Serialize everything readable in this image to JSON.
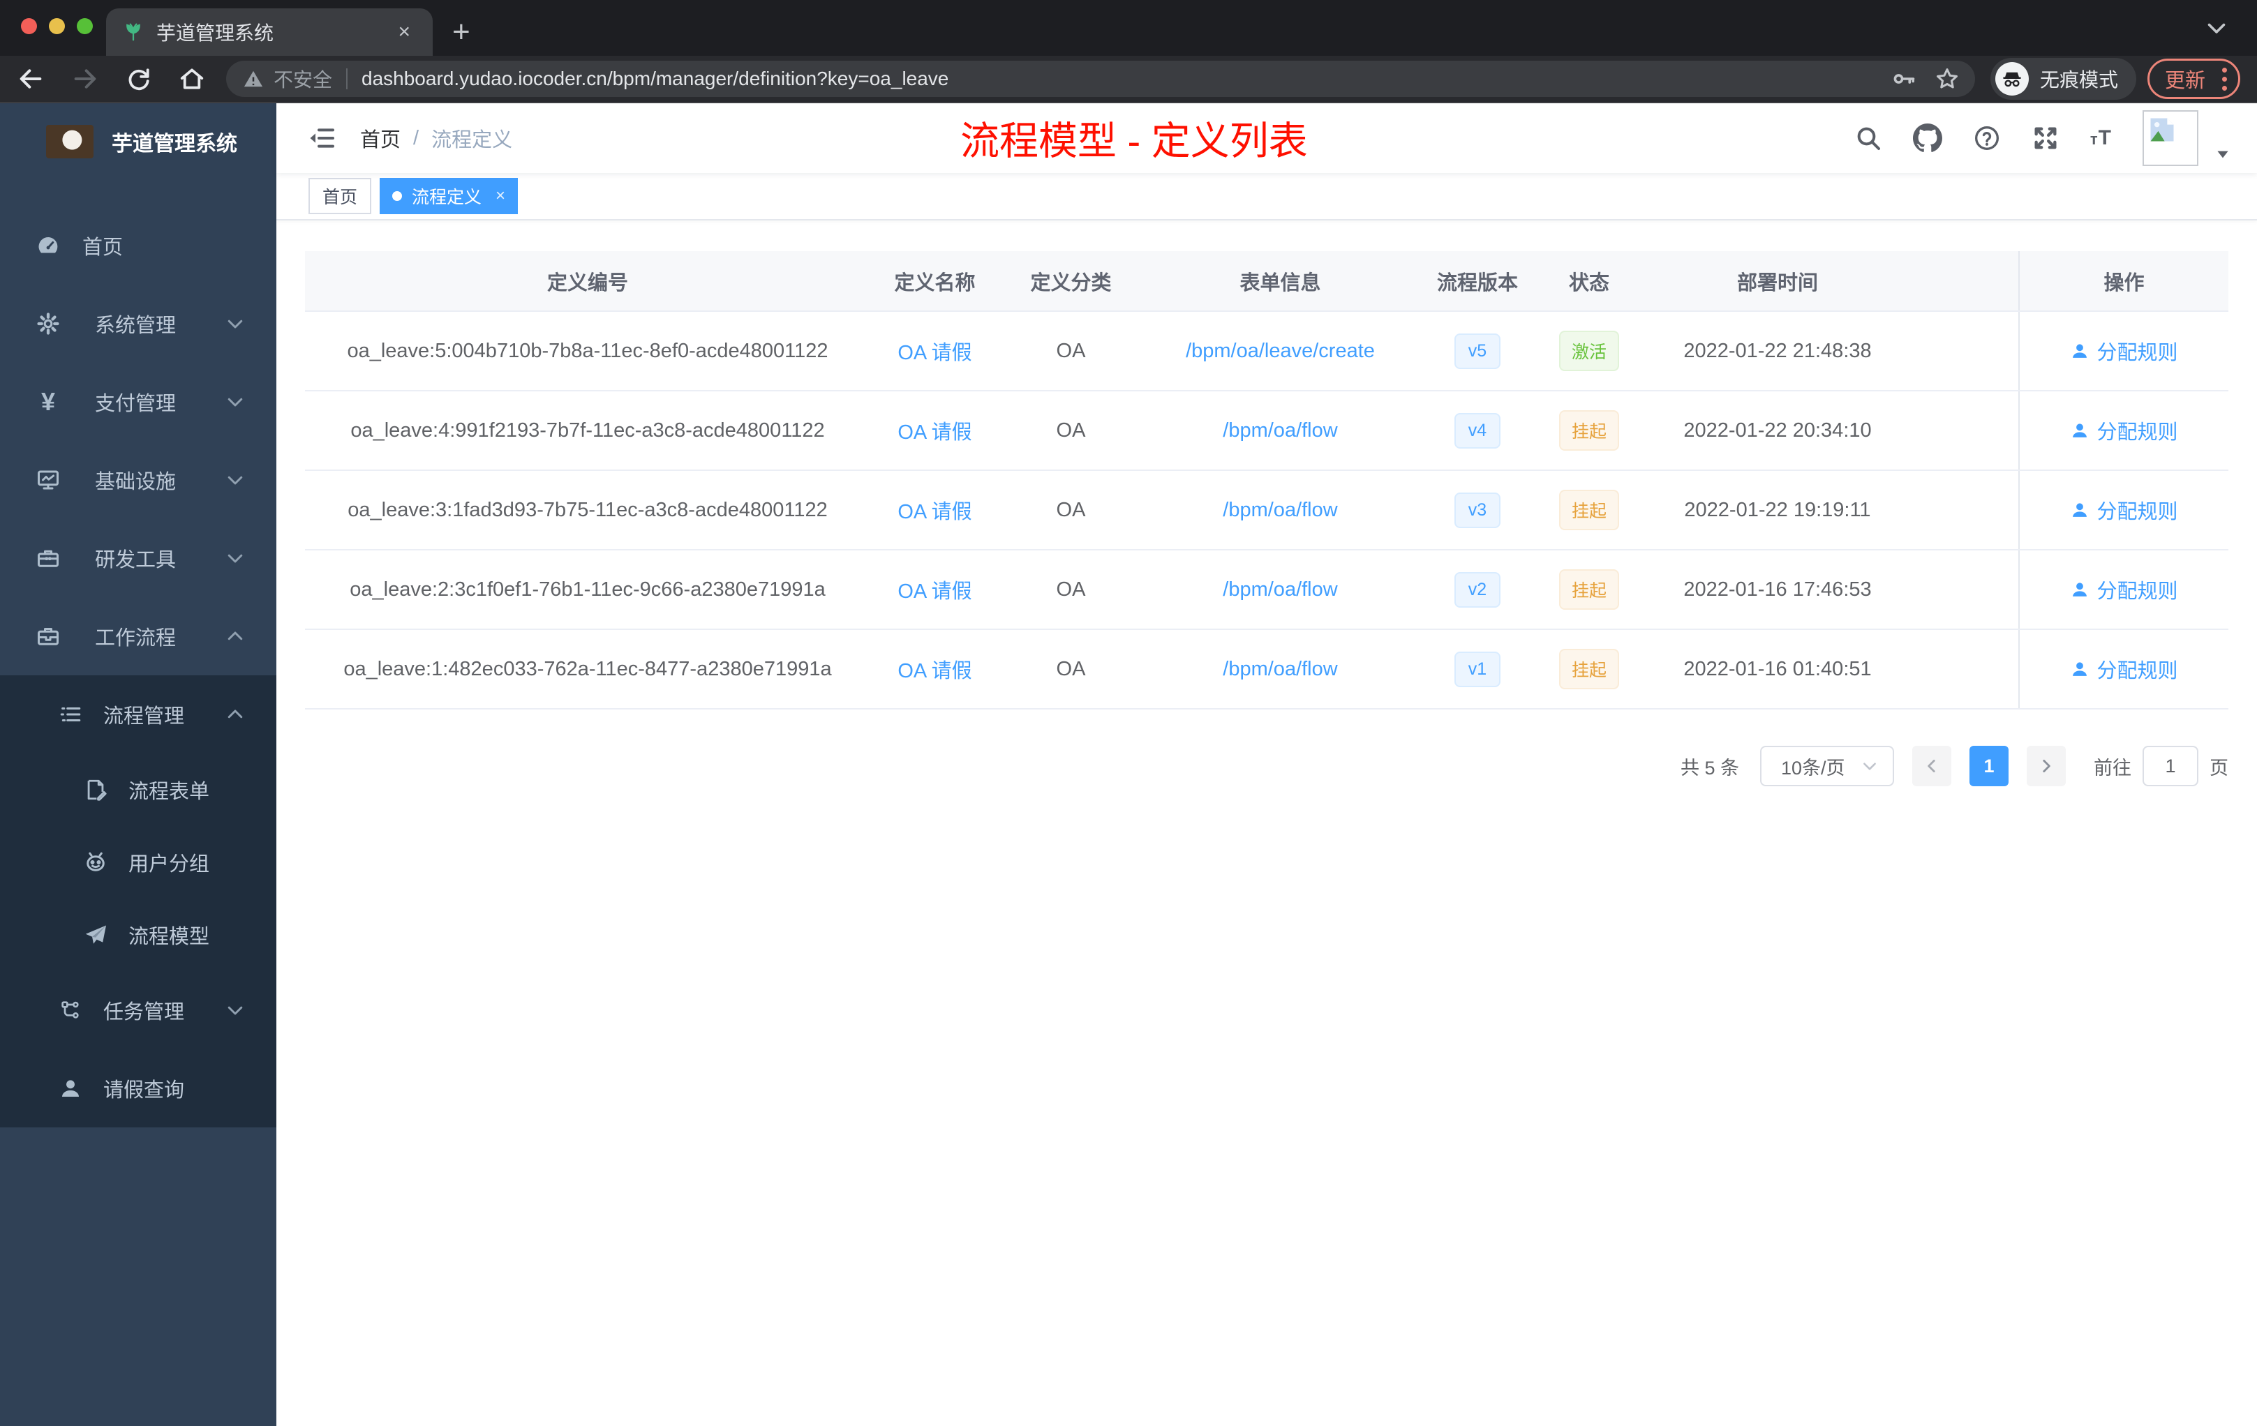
{
  "browser": {
    "tab_title": "芋道管理系统",
    "security_label": "不安全",
    "url": "dashboard.yudao.iocoder.cn/bpm/manager/definition?key=oa_leave",
    "incognito_label": "无痕模式",
    "update_label": "更新"
  },
  "sidebar": {
    "title": "芋道管理系统",
    "items": [
      {
        "label": "首页"
      },
      {
        "label": "系统管理"
      },
      {
        "label": "支付管理"
      },
      {
        "label": "基础设施"
      },
      {
        "label": "研发工具"
      },
      {
        "label": "工作流程"
      }
    ],
    "workflow_children": [
      {
        "label": "流程管理"
      },
      {
        "label": "流程表单"
      },
      {
        "label": "用户分组"
      },
      {
        "label": "流程模型"
      },
      {
        "label": "任务管理"
      },
      {
        "label": "请假查询"
      }
    ]
  },
  "navbar": {
    "breadcrumb_home": "首页",
    "breadcrumb_sep": "/",
    "breadcrumb_current": "流程定义",
    "annotation": "流程模型 - 定义列表",
    "font_icon_small": "т",
    "font_icon_big": "T"
  },
  "tags": {
    "home": "首页",
    "active": "流程定义",
    "close": "×"
  },
  "table": {
    "headers": [
      "定义编号",
      "定义名称",
      "定义分类",
      "表单信息",
      "流程版本",
      "状态",
      "部署时间",
      "操作"
    ],
    "action_label": "分配规则",
    "rows": [
      {
        "id": "oa_leave:5:004b710b-7b8a-11ec-8ef0-acde48001122",
        "name": "OA 请假",
        "category": "OA",
        "form": "/bpm/oa/leave/create",
        "version": "v5",
        "status": "激活",
        "time": "2022-01-22 21:48:38"
      },
      {
        "id": "oa_leave:4:991f2193-7b7f-11ec-a3c8-acde48001122",
        "name": "OA 请假",
        "category": "OA",
        "form": "/bpm/oa/flow",
        "version": "v4",
        "status": "挂起",
        "time": "2022-01-22 20:34:10"
      },
      {
        "id": "oa_leave:3:1fad3d93-7b75-11ec-a3c8-acde48001122",
        "name": "OA 请假",
        "category": "OA",
        "form": "/bpm/oa/flow",
        "version": "v3",
        "status": "挂起",
        "time": "2022-01-22 19:19:11"
      },
      {
        "id": "oa_leave:2:3c1f0ef1-76b1-11ec-9c66-a2380e71991a",
        "name": "OA 请假",
        "category": "OA",
        "form": "/bpm/oa/flow",
        "version": "v2",
        "status": "挂起",
        "time": "2022-01-16 17:46:53"
      },
      {
        "id": "oa_leave:1:482ec033-762a-11ec-8477-a2380e71991a",
        "name": "OA 请假",
        "category": "OA",
        "form": "/bpm/oa/flow",
        "version": "v1",
        "status": "挂起",
        "time": "2022-01-16 01:40:51"
      }
    ]
  },
  "pagination": {
    "total": "共 5 条",
    "page_size": "10条/页",
    "current_page": "1",
    "goto_label": "前往",
    "goto_value": "1",
    "page_unit": "页"
  },
  "colors": {
    "accent": "#409eff",
    "success": "#67c23a",
    "warning": "#e6a23c",
    "annotation_red": "#fe1000",
    "sidebar_bg": "#304156",
    "submenu_bg": "#1f2d3d"
  },
  "icon_names": [
    "plant-favicon",
    "close-icon",
    "new-tab-icon",
    "tab-search-icon",
    "back-icon",
    "forward-icon",
    "reload-icon",
    "home-icon",
    "warning-icon",
    "key-icon",
    "star-icon",
    "incognito-icon",
    "kebab-icon",
    "dashboard-icon",
    "gear-icon",
    "yen-icon",
    "monitor-icon",
    "toolbox-icon",
    "briefcase-icon",
    "list-icon",
    "doc-edit-icon",
    "robot-icon",
    "paper-plane-icon",
    "tree-icon",
    "user-icon",
    "hamburger-fold-icon",
    "search-icon",
    "github-icon",
    "question-icon",
    "fullscreen-icon",
    "font-size-icon",
    "broken-image-icon",
    "caret-down-icon",
    "chevron-icon"
  ]
}
